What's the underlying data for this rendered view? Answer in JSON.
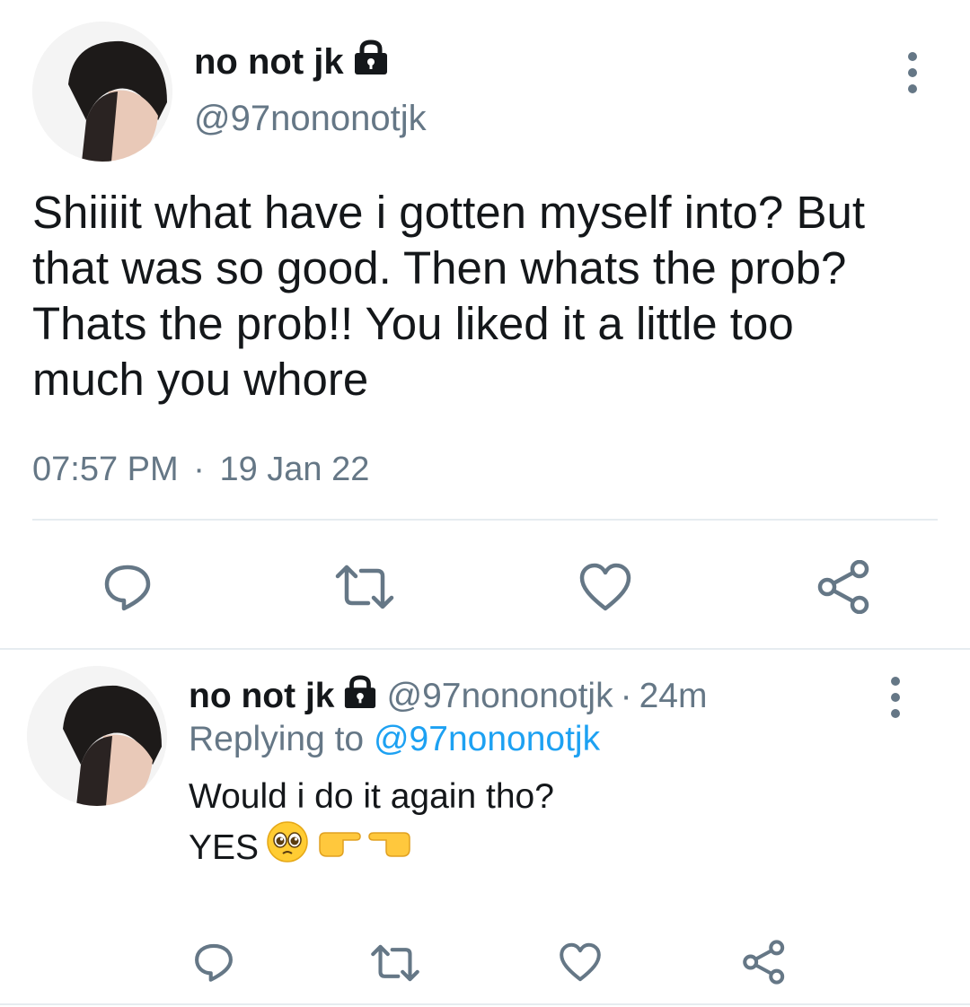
{
  "main_tweet": {
    "display_name": "no not jk",
    "handle": "@97nononotjk",
    "text_lines": [
      "Shiiiit what have i gotten myself into? But",
      "that was so good. Then whats the prob?",
      "Thats the prob!! You liked it a little too",
      "much you whore"
    ],
    "time": "07:57 PM",
    "separator": "·",
    "date": "19 Jan 22"
  },
  "reply_tweet": {
    "display_name": "no not jk",
    "handle": "@97nononotjk",
    "separator": "·",
    "age": "24m",
    "replying_label": "Replying to",
    "replying_handle": "@97nononotjk",
    "text_line1": "Would i do it again tho?",
    "text_line2": "YES"
  },
  "icons": {
    "lock": "lock-icon",
    "more": "more-vertical-icon",
    "reply": "reply-icon",
    "retweet": "retweet-icon",
    "like": "heart-icon",
    "share": "share-icon",
    "emoji": [
      "pleading-face-emoji",
      "pointing-right-emoji",
      "pointing-left-emoji"
    ]
  },
  "colors": {
    "text": "#14171a",
    "secondary": "#657786",
    "link": "#1da1f2",
    "divider": "#e6ecf0"
  }
}
